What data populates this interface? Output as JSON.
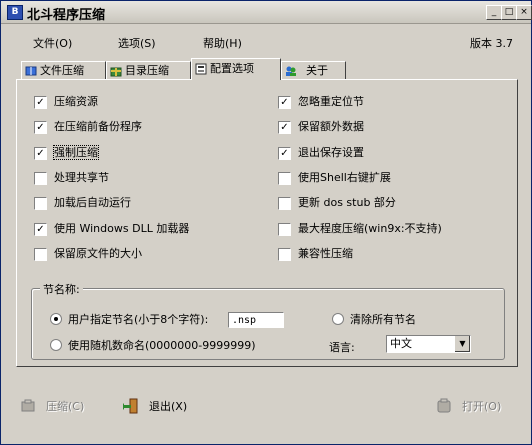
{
  "window": {
    "title": "北斗程序压缩",
    "app_icon": "B"
  },
  "menu": [
    {
      "label": "文件(O)"
    },
    {
      "label": "选项(S)"
    },
    {
      "label": "帮助(H)"
    }
  ],
  "version": "版本 3.7",
  "tabs": [
    {
      "label": "文件压缩",
      "icon": "book-icon"
    },
    {
      "label": "目录压缩",
      "icon": "gift-icon"
    },
    {
      "label": "配置选项",
      "icon": "config-icon",
      "active": true
    },
    {
      "label": "关于",
      "icon": "people-icon"
    }
  ],
  "options_left": [
    {
      "label": "压缩资源",
      "checked": true
    },
    {
      "label": "在压缩前备份程序",
      "checked": true
    },
    {
      "label": "强制压缩",
      "checked": true
    },
    {
      "label": "处理共享节",
      "checked": false
    },
    {
      "label": "加载后自动运行",
      "checked": false
    },
    {
      "label": "使用 Windows DLL 加载器",
      "checked": true
    },
    {
      "label": "保留原文件的大小",
      "checked": false
    }
  ],
  "options_right": [
    {
      "label": "忽略重定位节",
      "checked": true
    },
    {
      "label": "保留额外数据",
      "checked": true
    },
    {
      "label": "退出保存设置",
      "checked": true
    },
    {
      "label": "使用Shell右键扩展",
      "checked": false
    },
    {
      "label": "更新 dos stub 部分",
      "checked": false
    },
    {
      "label": "最大程度压缩(win9x:不支持)",
      "checked": false
    },
    {
      "label": "兼容性压缩",
      "checked": false
    }
  ],
  "section_group": {
    "legend": "节名称:",
    "radio_custom": "用户指定节名(小于8个字符):",
    "radio_custom_selected": true,
    "section_name_value": ".nsp",
    "radio_random": "使用随机数命名(0000000-9999999)",
    "clear_all": "清除所有节名",
    "language_label": "语言:",
    "language_value": "中文"
  },
  "buttons": {
    "compress": "压缩(C)",
    "exit": "退出(X)",
    "open": "打开(O)"
  }
}
